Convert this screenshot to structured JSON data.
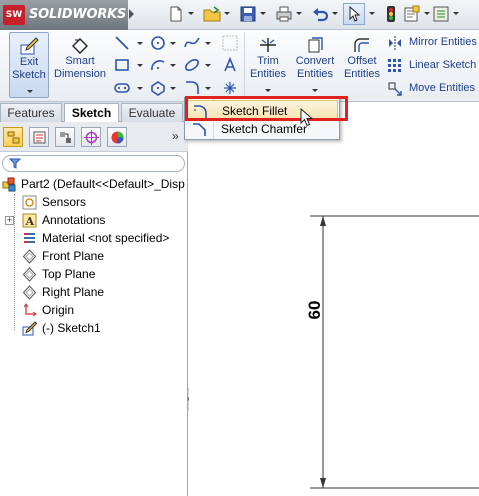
{
  "app": {
    "logo_badge": "SW",
    "logo_text": "SOLIDWORKS"
  },
  "ribbon": {
    "exit_sketch": "Exit Sketch",
    "smart_dimension": "Smart Dimension",
    "trim_entities": "Trim Entities",
    "convert_entities": "Convert Entities",
    "offset_entities": "Offset Entities",
    "mirror_entities": "Mirror Entities",
    "linear_sketch_pattern": "Linear Sketch P",
    "move_entities": "Move Entities"
  },
  "tabs": [
    {
      "label": "Features"
    },
    {
      "label": "Sketch",
      "active": true
    },
    {
      "label": "Evaluate"
    }
  ],
  "menu": {
    "items": [
      {
        "label": "Sketch Fillet",
        "highlighted": true
      },
      {
        "label": "Sketch Chamfer"
      }
    ]
  },
  "tree": {
    "root": "Part2  (Default<<Default>_Disp",
    "items": [
      {
        "label": "Sensors",
        "icon": "sensors-icon"
      },
      {
        "label": "Annotations",
        "icon": "annotations-icon",
        "expandable": true
      },
      {
        "label": "Material <not specified>",
        "icon": "material-icon"
      },
      {
        "label": "Front Plane",
        "icon": "plane-icon"
      },
      {
        "label": "Top Plane",
        "icon": "plane-icon"
      },
      {
        "label": "Right Plane",
        "icon": "plane-icon"
      },
      {
        "label": "Origin",
        "icon": "origin-icon"
      },
      {
        "label": "(-) Sketch1",
        "icon": "sketch-icon"
      }
    ]
  },
  "graphics": {
    "dimension_value": "60"
  },
  "colors": {
    "accent": "#1f3f8a",
    "callout": "#e0211e",
    "dimension": "#000000"
  }
}
